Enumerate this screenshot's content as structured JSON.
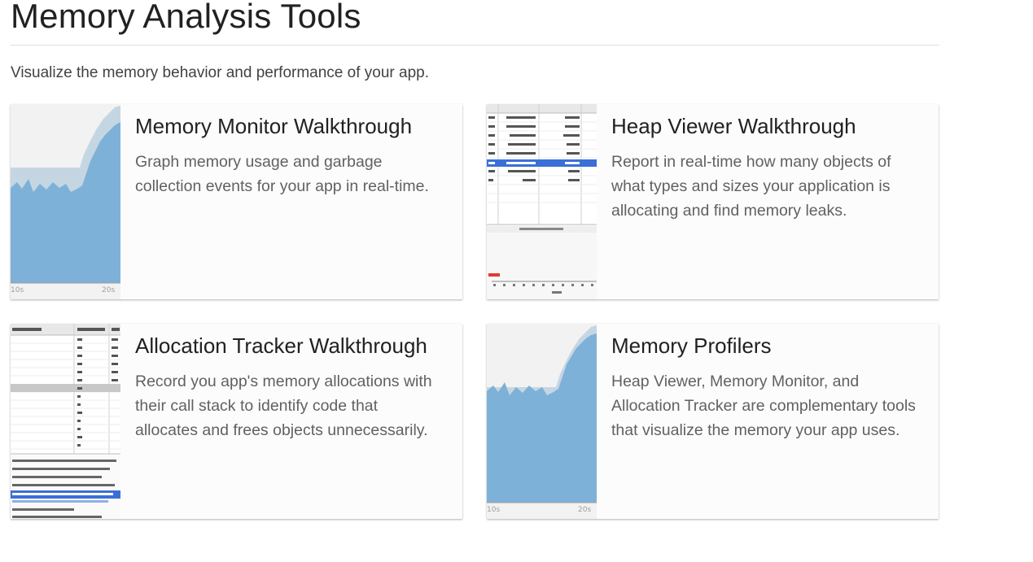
{
  "page": {
    "title": "Memory Analysis Tools",
    "intro": "Visualize the memory behavior and performance of your app."
  },
  "cards": [
    {
      "title": "Memory Monitor Walkthrough",
      "description": "Graph memory usage and garbage collection events for your app in real-time.",
      "thumbnail": "memory-monitor-graph"
    },
    {
      "title": "Heap Viewer Walkthrough",
      "description": "Report in real-time how many objects of what types and sizes your application is allocating and find memory leaks.",
      "thumbnail": "heap-viewer-table"
    },
    {
      "title": "Allocation Tracker Walkthrough",
      "description": "Record you app's memory allocations with their call stack to identify code that allocates and frees objects unnecessarily.",
      "thumbnail": "allocation-tracker-table"
    },
    {
      "title": "Memory Profilers",
      "description": "Heap Viewer, Memory Monitor, and Allocation Tracker are complementary tools that visualize the memory your app uses.",
      "thumbnail": "memory-monitor-graph"
    }
  ],
  "colors": {
    "graph_fill": "#7eb1d8",
    "graph_band": "#c5d6e3",
    "selection_row": "#3a6fd8",
    "text_primary": "#212121",
    "text_secondary": "#616161"
  }
}
